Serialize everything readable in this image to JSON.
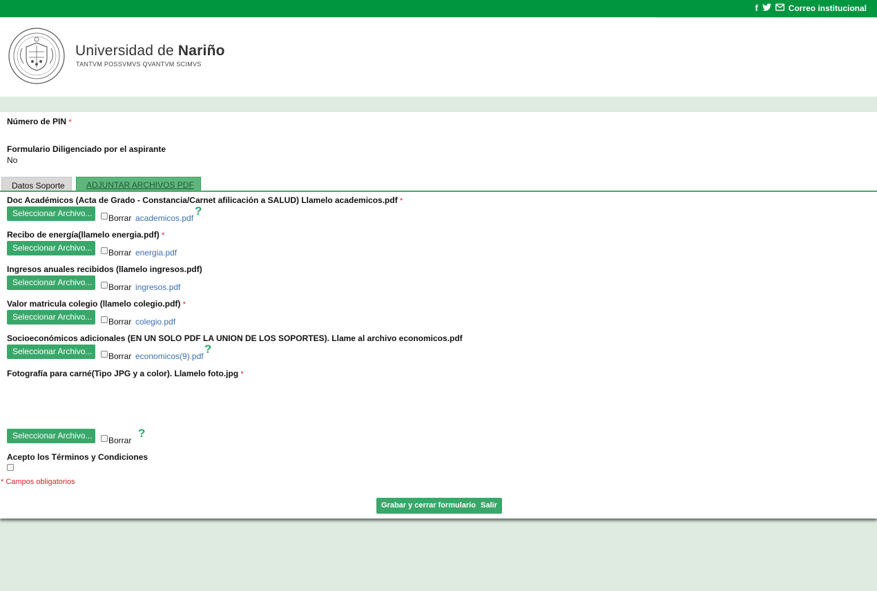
{
  "topbar": {
    "facebook_icon": "f",
    "twitter_icon": "twitter-bird",
    "mail_icon": "envelope",
    "mail_label": "Correo institucional"
  },
  "header": {
    "name_regular": "Universidad de ",
    "name_bold": "Nariño",
    "motto": "TANTVM POSSVMVS QVANTVM SCIMVS"
  },
  "form": {
    "pin_label": "Número de PIN",
    "diligenciado_label": "Formulario Diligenciado por el aspirante",
    "diligenciado_value": "No",
    "required_mark": "*",
    "tabs": [
      "Datos Soporte",
      "ADJUNTAR ARCHIVOS PDF"
    ],
    "select_label": "Seleccionar Archivo...",
    "borrar_label": "Borrar",
    "help_glyph": "?",
    "fields": [
      {
        "label": "Doc Académicos (Acta de Grado - Constancia/Carnet afilicación a SALUD) Llamelo academicos.pdf",
        "file": "academicos.pdf"
      },
      {
        "label": "Recibo de energía(llamelo energia.pdf)",
        "file": "energia.pdf"
      },
      {
        "label": "Ingresos anuales recibidos (llamelo ingresos.pdf)",
        "file": "ingresos.pdf"
      },
      {
        "label": "Valor matricula colegio (llamelo colegio.pdf)",
        "file": "colegio.pdf"
      },
      {
        "label": "Socioeconómicos adicionales (EN UN SOLO PDF LA UNION DE LOS SOPORTES). Llame al archivo economicos.pdf",
        "file": "economicos(9).pdf"
      },
      {
        "label": "Fotografía para carné(Tipo JPG y a color). Llamelo foto.jpg",
        "file": ""
      }
    ],
    "terms_label": "Acepto los Términos y Condiciones",
    "obligatorios": "* Campos obligatorios",
    "save_button": "Grabar y cerrar formulario",
    "exit_button": "Salir"
  },
  "colors": {
    "brand_green": "#009640",
    "button_green": "#3aa76a",
    "required_red": "#d9232d",
    "link_blue": "#3b6fb6"
  }
}
